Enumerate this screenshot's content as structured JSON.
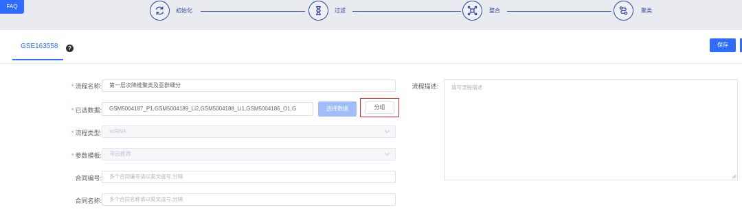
{
  "topbar": {
    "faq_label": "FAQ",
    "steps": [
      {
        "label": "初始化",
        "icon": "refresh-icon"
      },
      {
        "label": "过滤",
        "icon": "hourglass-icon"
      },
      {
        "label": "整合",
        "icon": "integrate-icon"
      },
      {
        "label": "聚类",
        "icon": "cluster-icon"
      }
    ]
  },
  "tabs": {
    "active_label": "GSE163558",
    "help_label": "?"
  },
  "toolbar": {
    "save_label": "保存"
  },
  "form": {
    "flow_name": {
      "label": "流程名称:",
      "value": "第一层次降维聚类及亚群细分"
    },
    "selected_data": {
      "label": "已选数据:",
      "value": "GSM5004187_P1,GSM5004189_Li2,GSM5004188_Li1,GSM5004186_O1,G",
      "select_button": "选择数据",
      "group_button": "分组"
    },
    "flow_type": {
      "label": "流程类型:",
      "value": "scRNA"
    },
    "param_template": {
      "label": "参数模板:",
      "value": "寻因推荐"
    },
    "contract_number": {
      "label": "合同编号:",
      "placeholder": "多个合同编号请以英文逗号,分隔"
    },
    "contract_name": {
      "label": "合同名称:",
      "placeholder": "多个合同名称请以英文逗号,分隔"
    },
    "description": {
      "label": "流程描述:",
      "placeholder": "填写流程描述"
    },
    "required_mark": "*"
  },
  "colors": {
    "primary": "#2f6bff",
    "step_accent": "#2e4a9a",
    "highlight_border": "#e02424",
    "required": "#f56c6c"
  }
}
